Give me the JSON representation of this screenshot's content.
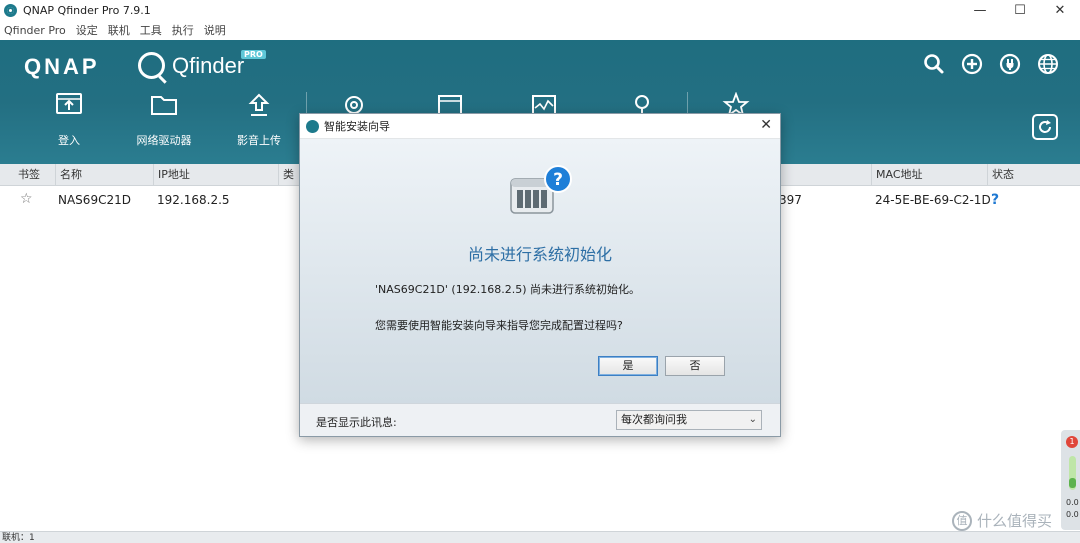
{
  "window": {
    "title": "QNAP Qfinder Pro 7.9.1"
  },
  "menu": [
    "Qfinder Pro",
    "设定",
    "联机",
    "工具",
    "执行",
    "说明"
  ],
  "header": {
    "brand": "QNAP",
    "product": "Qfinder",
    "badge": "PRO",
    "header_icons": [
      "search-icon",
      "add-icon",
      "power-icon",
      "globe-icon"
    ]
  },
  "toolbar": {
    "items": [
      {
        "label": "登入",
        "icon": "login-icon"
      },
      {
        "label": "网络驱动器",
        "icon": "folder-icon"
      },
      {
        "label": "影音上传",
        "icon": "upload-icon"
      }
    ]
  },
  "table": {
    "headers": [
      "书签",
      "名称",
      "IP地址",
      "类",
      "MAC地址",
      "状态"
    ],
    "rows": [
      {
        "name": "NAS69C21D",
        "ip": "192.168.2.5",
        "partial": "397",
        "mac": "24-5E-BE-69-C2-1D",
        "status": "?"
      }
    ]
  },
  "status_bar": {
    "text": "联机：1"
  },
  "side_gadget": {
    "alert_count": "1",
    "val1": "0.0",
    "val2": "0.0"
  },
  "watermark": {
    "text": "什么值得买"
  },
  "dialog": {
    "title": "智能安装向导",
    "heading": "尚未进行系统初始化",
    "message1": "'NAS69C21D' (192.168.2.5) 尚未进行系统初始化。",
    "message2": "您需要使用智能安装向导来指导您完成配置过程吗?",
    "yes_label": "是",
    "no_label": "否",
    "footer_label": "是否显示此讯息:",
    "footer_select": "每次都询问我"
  }
}
